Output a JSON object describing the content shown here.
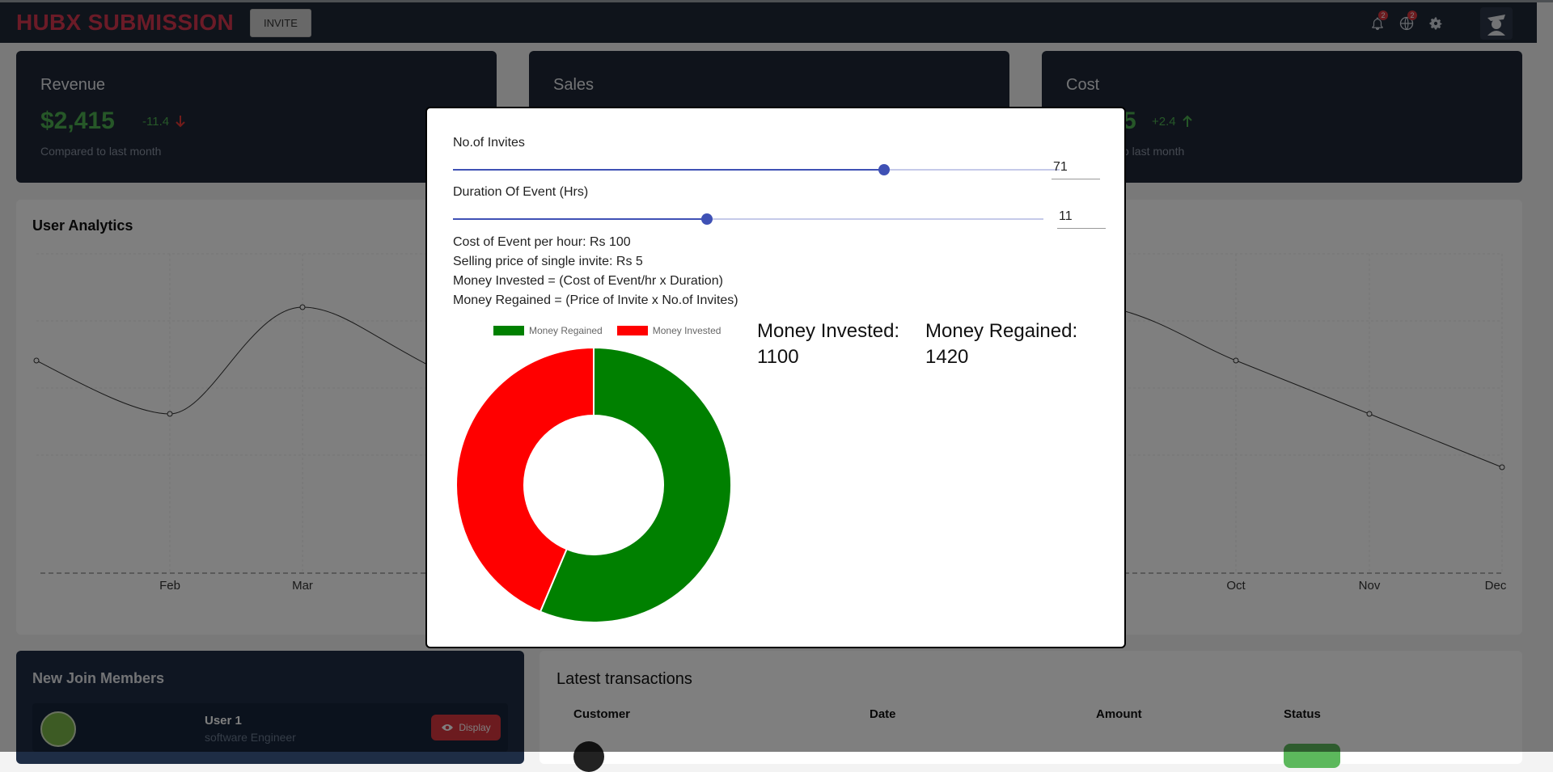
{
  "header": {
    "brand": "HUBX SUBMISSION",
    "invite_label": "INVITE",
    "notifications_count": "2",
    "language_count": "2"
  },
  "cards": [
    {
      "title": "Revenue",
      "value": "$2,415",
      "rate": "-11.4",
      "trend": "down",
      "subtitle": "Compared to last month"
    },
    {
      "title": "Sales",
      "value": "",
      "rate": "",
      "trend": "",
      "subtitle": ""
    },
    {
      "title": "Cost",
      "value": "5",
      "rate": "+2.4",
      "trend": "up",
      "subtitle": "o last month"
    }
  ],
  "analytics": {
    "title": "User Analytics",
    "chart_data": {
      "type": "line",
      "categories_visible": [
        "Feb",
        "Mar",
        "Oct",
        "Nov",
        "Dec"
      ],
      "grid": true
    }
  },
  "members": {
    "title": "New Join Members",
    "items": [
      {
        "name": "User 1",
        "role": "software Engineer",
        "button": "Display"
      }
    ]
  },
  "transactions": {
    "title": "Latest transactions",
    "headers": [
      "Customer",
      "Date",
      "Amount",
      "Status"
    ]
  },
  "modal": {
    "invites_label": "No.of Invites",
    "invites_value": "71",
    "invites_fraction": 0.71,
    "duration_label": "Duration Of Event (Hrs)",
    "duration_value": "11",
    "duration_fraction": 0.43,
    "info_lines": [
      "Cost of Event per hour: Rs 100",
      "Selling price of single invite: Rs 5",
      "Money Invested = (Cost of Event/hr x Duration)",
      "Money Regained = (Price of Invite x No.of Invites)"
    ],
    "invested_label": "Money Invested:",
    "invested_value": "1100",
    "regained_label": "Money Regained:",
    "regained_value": "1420",
    "chart_data": {
      "type": "pie",
      "variant": "doughnut",
      "legend_position": "top",
      "categories": [
        "Money Regained",
        "Money Invested"
      ],
      "values": [
        1420,
        1100
      ],
      "colors": [
        "#008000",
        "#ff0000"
      ]
    }
  }
}
